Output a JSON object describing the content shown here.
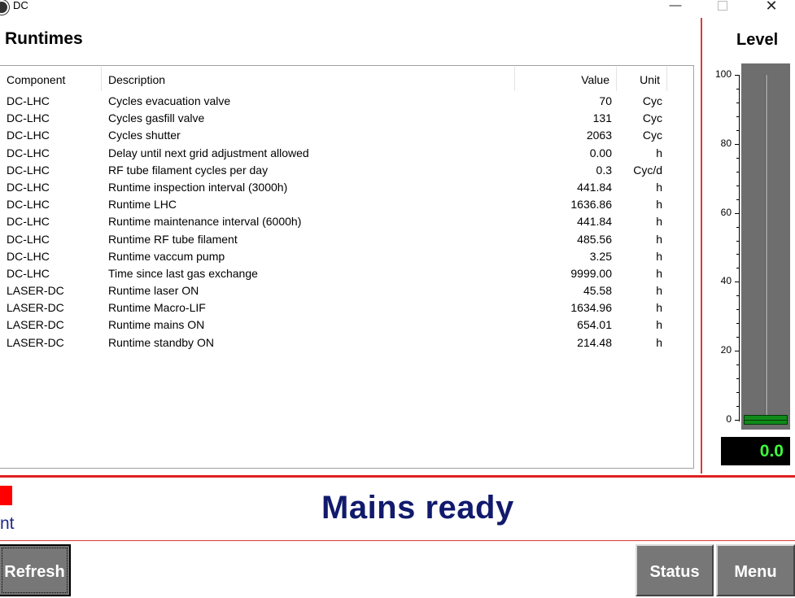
{
  "window": {
    "title": "DC",
    "minimize": "—",
    "close": "✕"
  },
  "runtimes": {
    "title": "Runtimes",
    "columns": {
      "component": "Component",
      "description": "Description",
      "value": "Value",
      "unit": "Unit"
    },
    "rows": [
      {
        "component": "DC-LHC",
        "description": "Cycles evacuation valve",
        "value": "70",
        "unit": "Cyc"
      },
      {
        "component": "DC-LHC",
        "description": "Cycles gasfill valve",
        "value": "131",
        "unit": "Cyc"
      },
      {
        "component": "DC-LHC",
        "description": "Cycles shutter",
        "value": "2063",
        "unit": "Cyc"
      },
      {
        "component": "DC-LHC",
        "description": "Delay until next grid adjustment allowed",
        "value": "0.00",
        "unit": "h"
      },
      {
        "component": "DC-LHC",
        "description": "RF tube filament cycles per day",
        "value": "0.3",
        "unit": "Cyc/d"
      },
      {
        "component": "DC-LHC",
        "description": "Runtime inspection interval (3000h)",
        "value": "441.84",
        "unit": "h"
      },
      {
        "component": "DC-LHC",
        "description": "Runtime LHC",
        "value": "1636.86",
        "unit": "h"
      },
      {
        "component": "DC-LHC",
        "description": "Runtime maintenance interval (6000h)",
        "value": "441.84",
        "unit": "h"
      },
      {
        "component": "DC-LHC",
        "description": "Runtime RF tube filament",
        "value": "485.56",
        "unit": "h"
      },
      {
        "component": "DC-LHC",
        "description": "Runtime vaccum pump",
        "value": "3.25",
        "unit": "h"
      },
      {
        "component": "DC-LHC",
        "description": "Time since last gas exchange",
        "value": "9999.00",
        "unit": "h"
      },
      {
        "component": "LASER-DC",
        "description": "Runtime laser ON",
        "value": "45.58",
        "unit": "h"
      },
      {
        "component": "LASER-DC",
        "description": "Runtime Macro-LIF",
        "value": "1634.96",
        "unit": "h"
      },
      {
        "component": "LASER-DC",
        "description": "Runtime mains ON",
        "value": "654.01",
        "unit": "h"
      },
      {
        "component": "LASER-DC",
        "description": "Runtime standby ON",
        "value": "214.48",
        "unit": "h"
      }
    ]
  },
  "level": {
    "title": "Level",
    "scale_labels": [
      "100",
      "80",
      "60",
      "40",
      "20",
      "0"
    ],
    "scale_min": 0,
    "scale_max": 100,
    "current_value": 0.0,
    "readout": "0.0",
    "fill_color": "#0f8a1a",
    "readout_color": "#3cff3c"
  },
  "status": {
    "message": "Mains ready",
    "clipped_text": "nt",
    "indicator_color": "#ff0000"
  },
  "buttons": {
    "refresh": "Refresh",
    "status": "Status",
    "menu": "Menu"
  }
}
